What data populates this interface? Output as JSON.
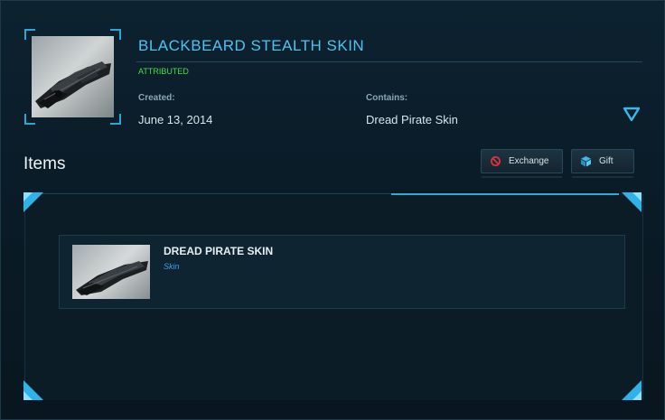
{
  "pledge": {
    "title": "BLACKBEARD STEALTH SKIN",
    "status": "ATTRIBUTED",
    "created_label": "Created:",
    "created_value": "June 13, 2014",
    "contains_label": "Contains:",
    "contains_value": "Dread Pirate Skin"
  },
  "items_section": {
    "heading": "Items",
    "buttons": {
      "exchange_label": "Exchange",
      "gift_label": "Gift"
    },
    "items": [
      {
        "name": "DREAD PIRATE SKIN",
        "type": "Skin"
      }
    ]
  },
  "icons": {
    "exchange": "no-symbol-icon",
    "gift": "gift-box-icon",
    "expand": "triangle-down-icon"
  },
  "colors": {
    "accent": "#4fc3f0",
    "status_green": "#45e045",
    "item_type_blue": "#3fa3e6",
    "exchange_icon_red": "#e0303a"
  }
}
